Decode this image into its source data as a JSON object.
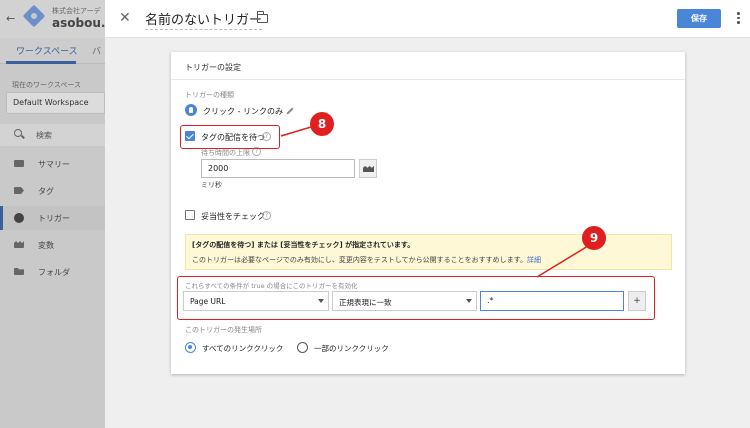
{
  "shell": {
    "company": "株式会社アーデ",
    "account": "asobou.co",
    "tab_workspace": "ワークスペース",
    "tab_more": "バ",
    "workspace_label": "現在のワークスペース",
    "workspace_name": "Default Workspace",
    "search": "検索",
    "nav": [
      "サマリー",
      "タグ",
      "トリガー",
      "変数",
      "フォルダ"
    ]
  },
  "panel": {
    "title": "名前のないトリガー",
    "save_label": "保存"
  },
  "card": {
    "title": "トリガーの設定",
    "type_label": "トリガーの種類",
    "type_value": "クリック - リンクのみ",
    "wait_for_tags": "タグの配信を待つ",
    "wait_limit_label": "待ち時間の上限",
    "wait_limit_value": "2000",
    "ms_label": "ミリ秒",
    "check_validation": "妥当性をチェック",
    "help": "?",
    "notice_title": "[タグの配信を待つ] または [妥当性をチェック] が指定されています。",
    "notice_body": "このトリガーは必要なページでのみ有効にし、変更内容をテストしてから公開することをおすすめします。",
    "notice_link": "詳細",
    "condition_label": "これらすべての条件が true の場合にこのトリガーを有効化",
    "condition_variable": "Page URL",
    "condition_operator": "正規表現に一致",
    "condition_value": ".*",
    "plus": "+",
    "fire_label": "このトリガーの発生場所",
    "radio_all": "すべてのリンククリック",
    "radio_some": "一部のリンククリック"
  },
  "annotations": {
    "badge_8": "8",
    "badge_9": "9",
    "color": "#e02020"
  }
}
